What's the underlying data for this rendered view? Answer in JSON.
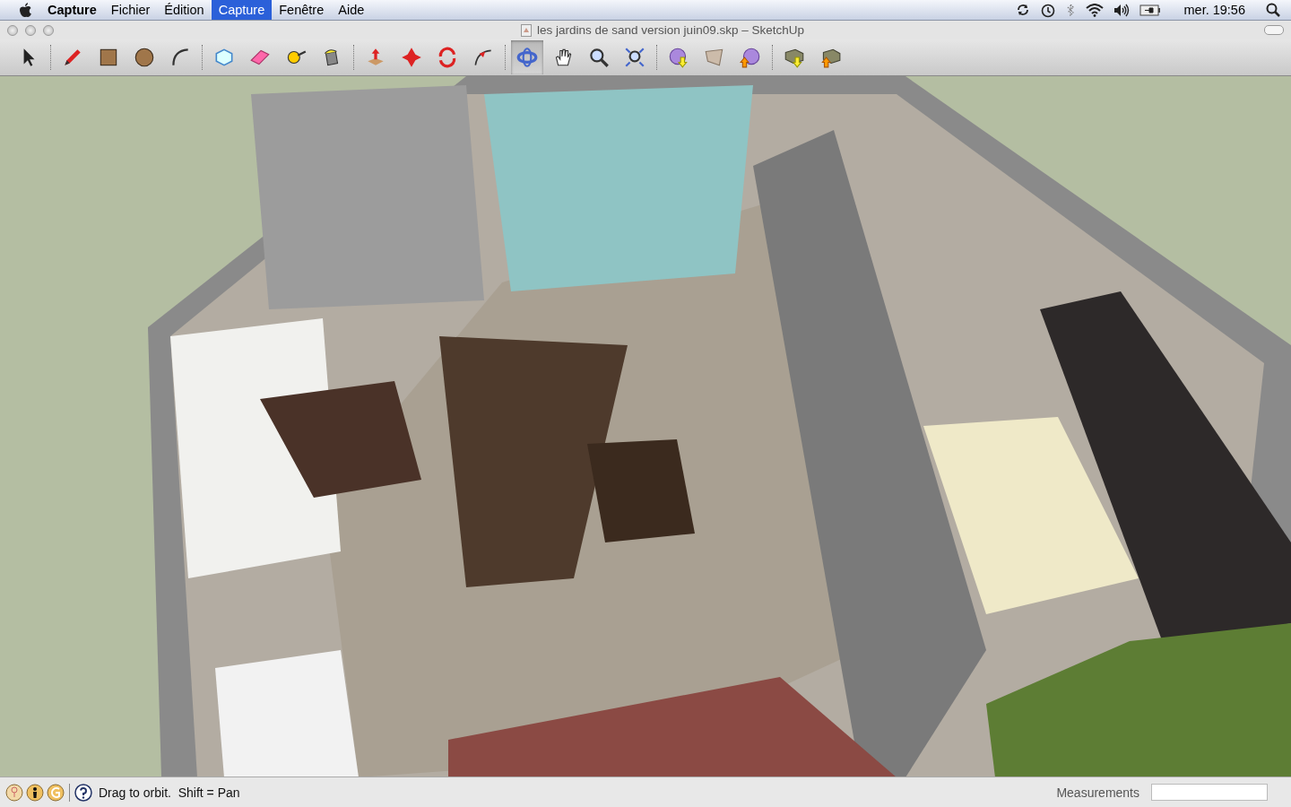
{
  "menu_bar": {
    "app_name": "Capture",
    "menus": [
      {
        "label": "Fichier",
        "selected": false
      },
      {
        "label": "Édition",
        "selected": false
      },
      {
        "label": "Capture",
        "selected": true
      },
      {
        "label": "Fenêtre",
        "selected": false
      },
      {
        "label": "Aide",
        "selected": false
      }
    ],
    "clock": "mer. 19:56"
  },
  "window": {
    "title": "les jardins de sand version juin09.skp – SketchUp"
  },
  "toolbar": {
    "groups": [
      [
        {
          "kind": "select",
          "selected": false
        }
      ],
      [
        {
          "kind": "pencil",
          "selected": false
        },
        {
          "kind": "rectangle",
          "selected": false
        },
        {
          "kind": "circle",
          "selected": false
        },
        {
          "kind": "arc",
          "selected": false
        }
      ],
      [
        {
          "kind": "component",
          "selected": false
        },
        {
          "kind": "eraser",
          "selected": false
        },
        {
          "kind": "tape",
          "selected": false
        },
        {
          "kind": "paint",
          "selected": false
        }
      ],
      [
        {
          "kind": "pushpull",
          "selected": false
        },
        {
          "kind": "move",
          "selected": false
        },
        {
          "kind": "rotate",
          "selected": false
        },
        {
          "kind": "followme",
          "selected": false
        }
      ],
      [
        {
          "kind": "orbit",
          "selected": true
        },
        {
          "kind": "pan",
          "selected": false
        },
        {
          "kind": "zoom",
          "selected": false
        },
        {
          "kind": "zoomextents",
          "selected": false
        }
      ],
      [
        {
          "kind": "getmodels",
          "selected": false
        },
        {
          "kind": "phototexture",
          "selected": false
        },
        {
          "kind": "sharemodel",
          "selected": false
        }
      ],
      [
        {
          "kind": "getcomponent",
          "selected": false
        },
        {
          "kind": "sharecomponent",
          "selected": false
        }
      ]
    ]
  },
  "status_bar": {
    "hint": "Drag to orbit.  Shift = Pan",
    "measurements_label": "Measurements"
  }
}
